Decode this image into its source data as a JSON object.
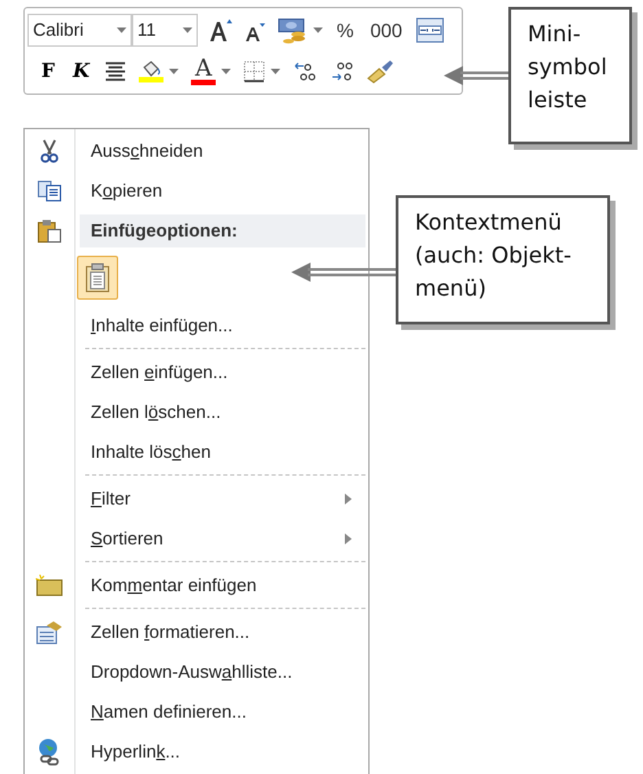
{
  "mini_toolbar": {
    "font": {
      "value": "Calibri"
    },
    "size": {
      "value": "11"
    },
    "row_1": [
      {
        "kind": "icon"
      },
      {
        "kind": "icon"
      },
      {
        "kind": "icon",
        "dropdown": true
      },
      {
        "kind": "text",
        "label": "%"
      },
      {
        "kind": "text",
        "label": "000"
      },
      {
        "kind": "icon"
      }
    ],
    "row_2": [
      {
        "kind": "text",
        "label": "F"
      },
      {
        "kind": "text",
        "label": "K"
      },
      {
        "kind": "icon"
      },
      {
        "kind": "color",
        "color": "#ffff00",
        "dropdown": true
      },
      {
        "kind": "color",
        "label": "A",
        "color": "#ff0000",
        "dropdown": true
      },
      {
        "kind": "icon",
        "dropdown": true
      },
      {
        "kind": "icon"
      },
      {
        "kind": "icon"
      },
      {
        "kind": "icon"
      }
    ]
  },
  "context_menu": {
    "items": [
      {
        "kind": "item",
        "before": "Auss",
        "key": "c",
        "after": "hneiden"
      },
      {
        "kind": "item",
        "before": "K",
        "key": "o",
        "after": "pieren"
      },
      {
        "kind": "header",
        "label": "Einfügeoptionen:"
      },
      {
        "kind": "paste-options"
      },
      {
        "kind": "item",
        "key": "I",
        "after": "nhalte einfügen..."
      },
      {
        "kind": "separator"
      },
      {
        "kind": "item",
        "before": "Zellen ",
        "key": "e",
        "after": "infügen..."
      },
      {
        "kind": "item",
        "before": "Zellen l",
        "key": "ö",
        "after": "schen..."
      },
      {
        "kind": "item",
        "before": "Inhalte lös",
        "key": "c",
        "after": "hen"
      },
      {
        "kind": "separator"
      },
      {
        "kind": "item",
        "key": "F",
        "after": "ilter",
        "submenu": true
      },
      {
        "kind": "item",
        "key": "S",
        "after": "ortieren",
        "submenu": true
      },
      {
        "kind": "separator"
      },
      {
        "kind": "item",
        "before": "Kom",
        "key": "m",
        "after": "entar einfügen"
      },
      {
        "kind": "separator"
      },
      {
        "kind": "item",
        "before": "Zellen ",
        "key": "f",
        "after": "ormatieren..."
      },
      {
        "kind": "item",
        "before": "Dropdown-Ausw",
        "key": "a",
        "after": "hlliste..."
      },
      {
        "kind": "item",
        "key": "N",
        "after": "amen definieren..."
      },
      {
        "kind": "item",
        "before": "Hyperlin",
        "key": "k",
        "after": "..."
      }
    ]
  },
  "callouts": [
    {
      "text": "Mini-symbol leiste"
    },
    {
      "text": "Kontextmenü (auch: Objekt-menü)"
    }
  ]
}
